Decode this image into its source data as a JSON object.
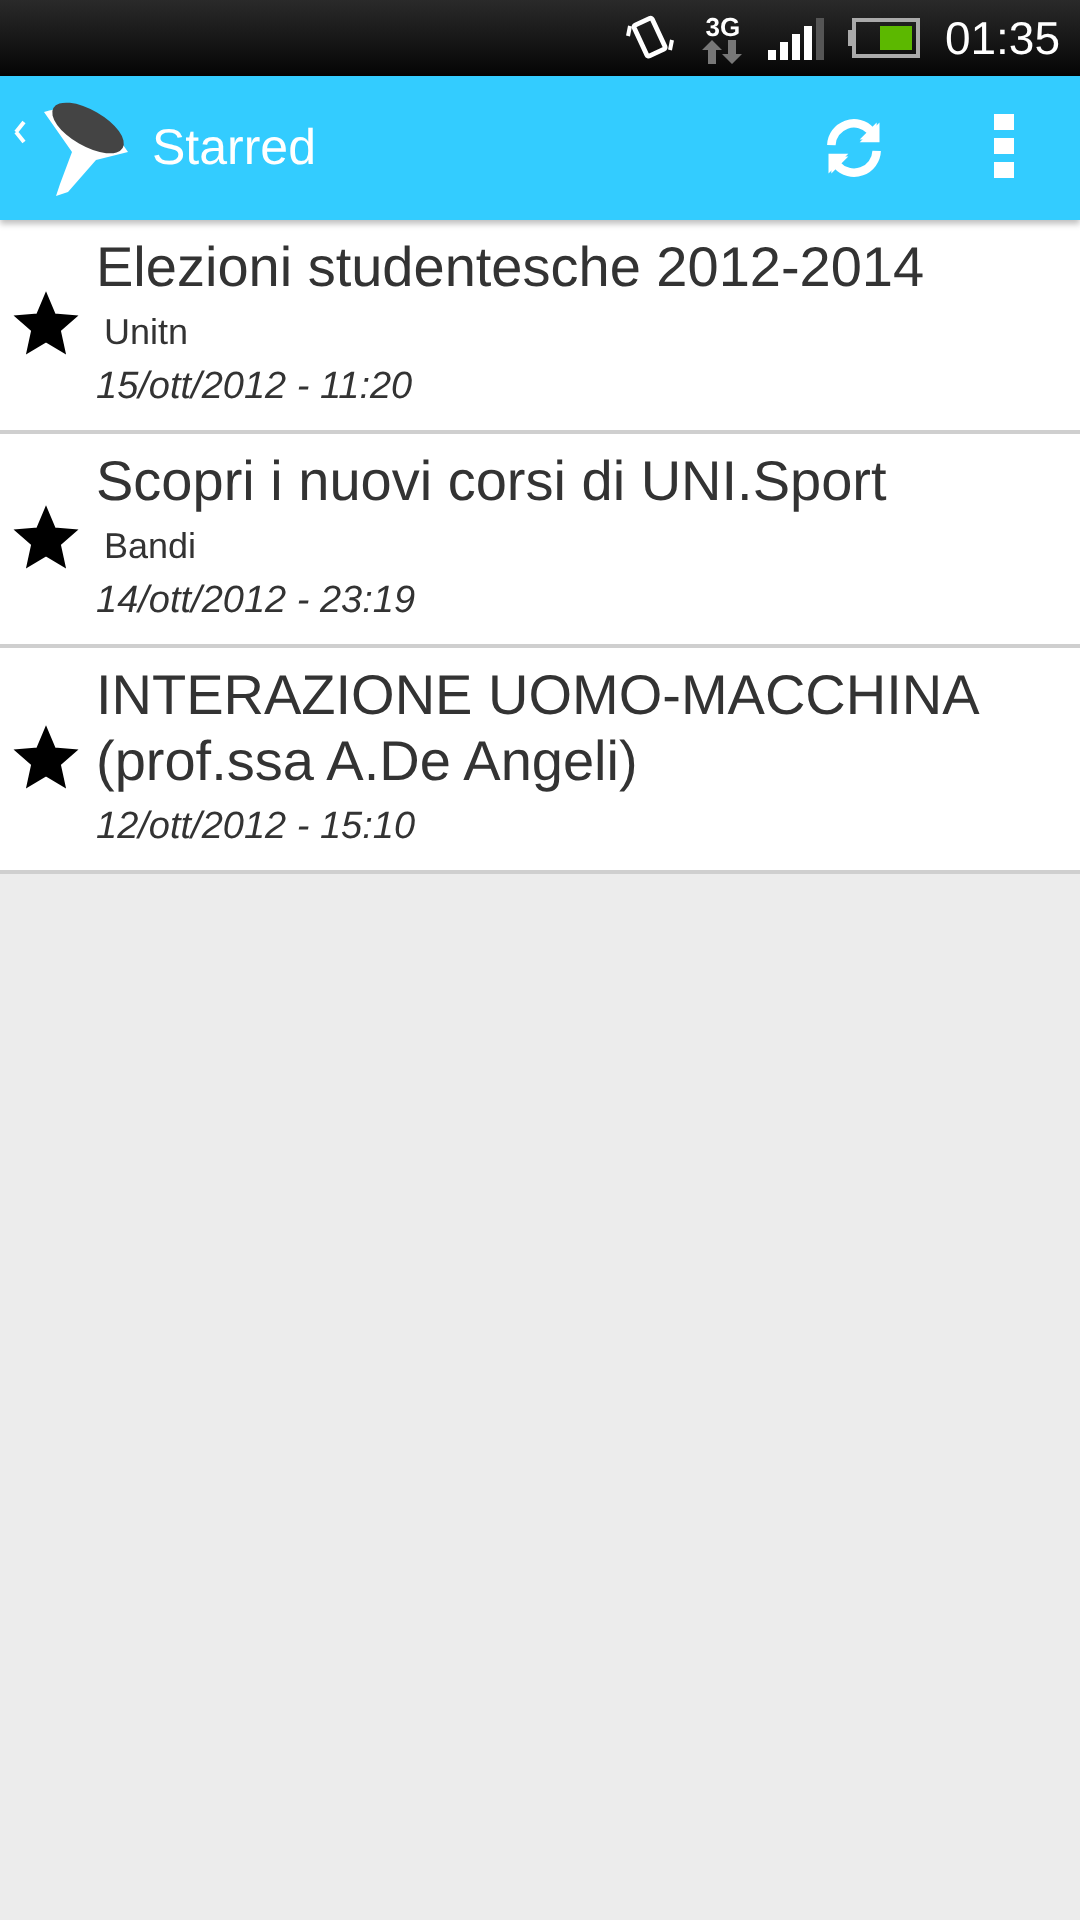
{
  "status_bar": {
    "network": "3G",
    "time": "01:35"
  },
  "action_bar": {
    "title": "Starred"
  },
  "items": [
    {
      "title": "Elezioni studentesche 2012-2014",
      "category": "Unitn",
      "date": "15/ott/2012 - 11:20",
      "starred": true
    },
    {
      "title": "Scopri i nuovi corsi di UNI.Sport",
      "category": "Bandi",
      "date": "14/ott/2012 - 23:19",
      "starred": true
    },
    {
      "title": "INTERAZIONE UOMO-MACCHINA (prof.ssa A.De Angeli)",
      "date": "12/ott/2012 - 15:10",
      "starred": true
    }
  ]
}
